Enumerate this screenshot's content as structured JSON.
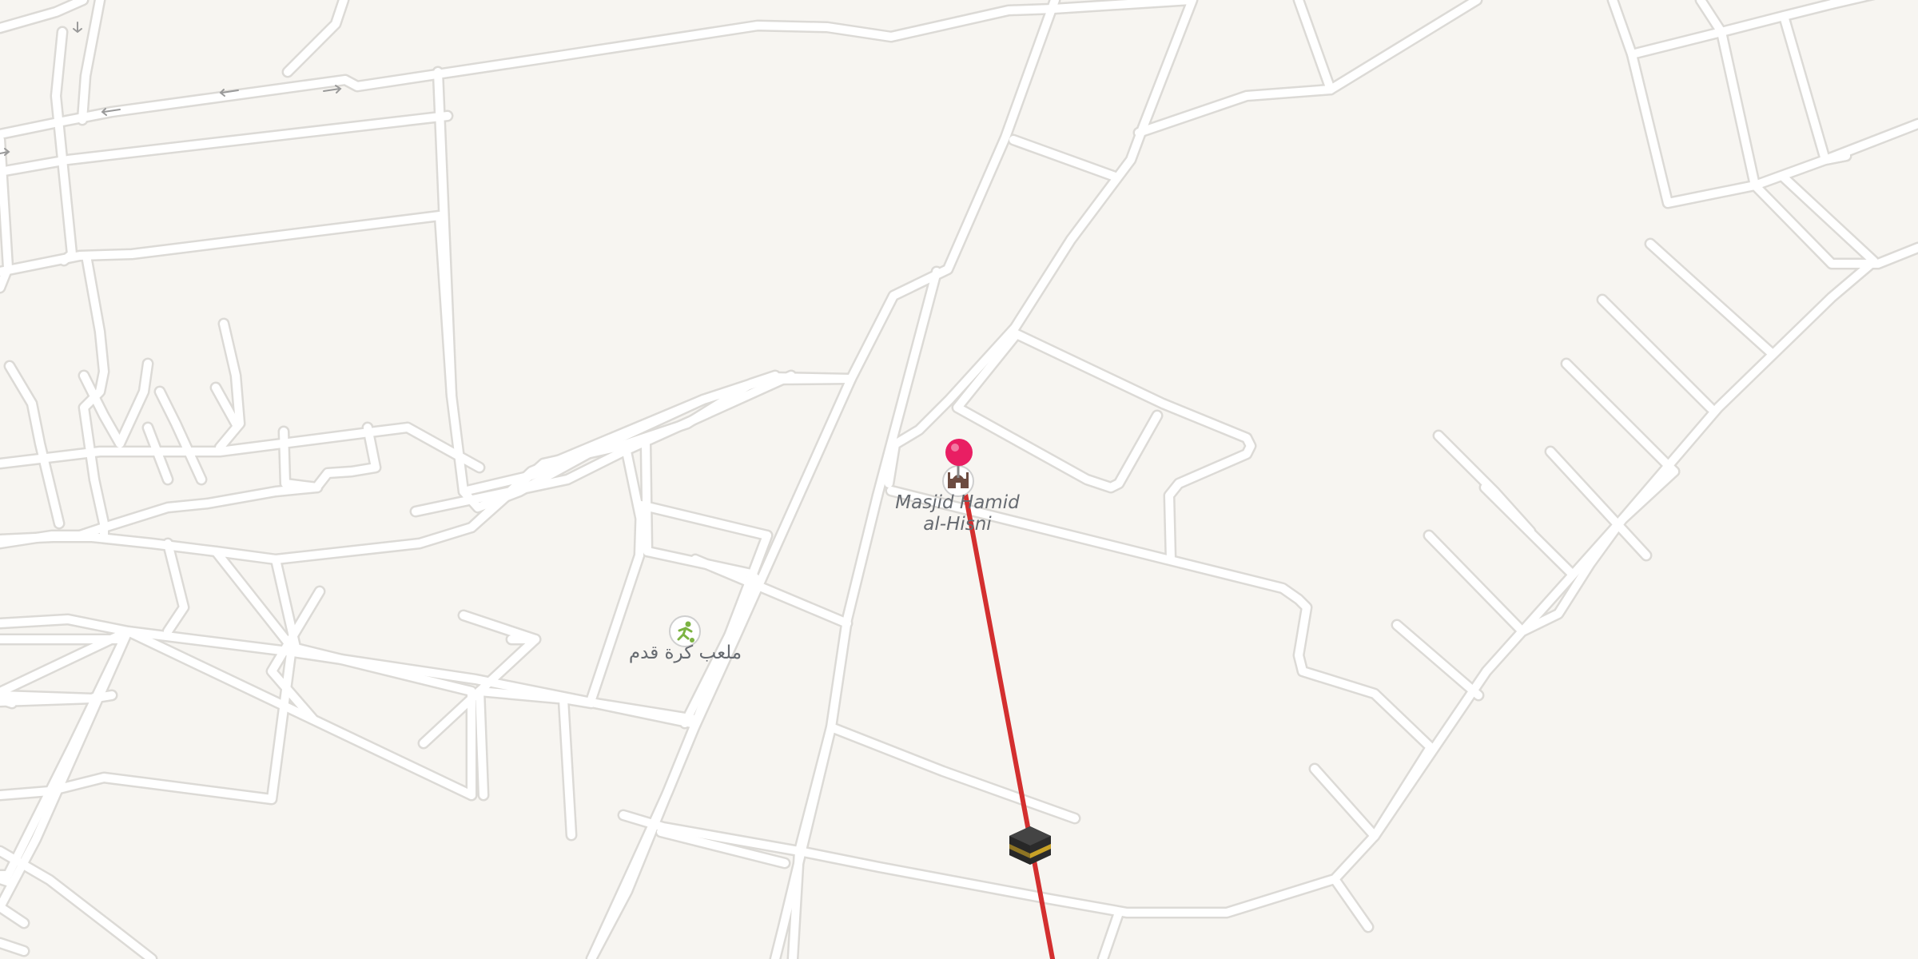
{
  "map": {
    "background_color": "#f7f5f1",
    "road_color": "#ffffff",
    "road_outline_color": "#dcdad6",
    "route_line_color": "#d32f2f"
  },
  "pins": {
    "selected_location_pin": {
      "color": "#e91e63",
      "icon": "map-pin-icon"
    },
    "qibla_marker": {
      "icon": "kaaba-icon",
      "meaning": "Kaaba (qibla direction)"
    }
  },
  "pois": {
    "mosque": {
      "name_line1": "Masjid Hamid",
      "name_line2": "al-Hisni",
      "icon": "mosque-icon",
      "icon_color": "#6d4c41"
    },
    "football_field": {
      "name": "ملعب كرة قدم",
      "icon": "football-player-icon",
      "icon_color": "#7cb342"
    }
  }
}
